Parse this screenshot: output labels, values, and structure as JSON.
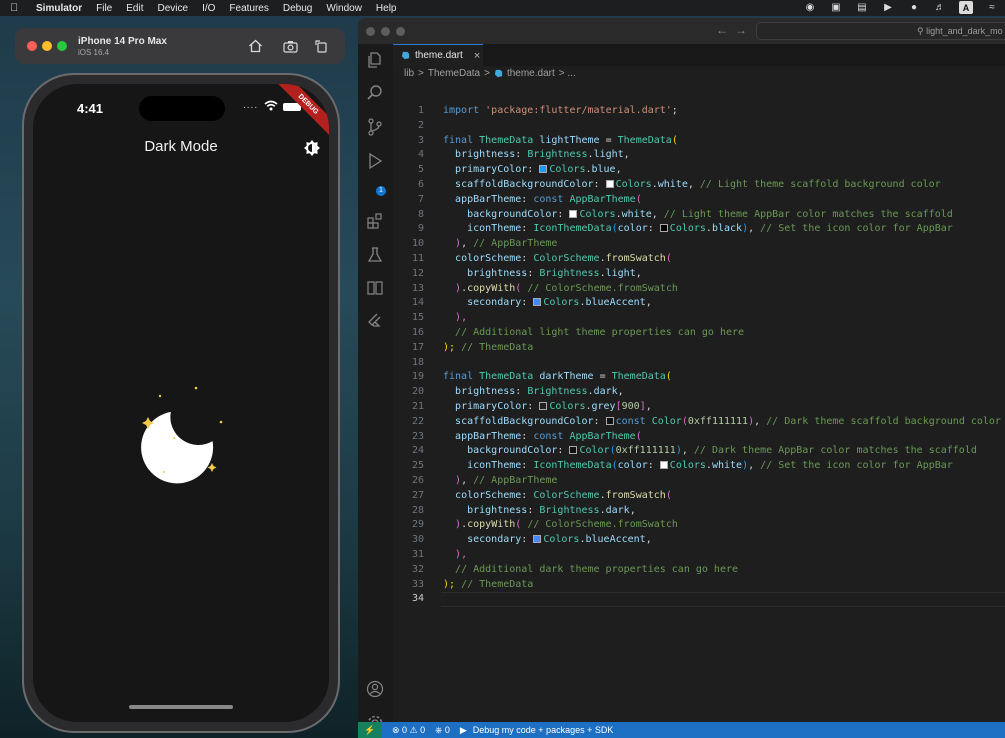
{
  "menubar": {
    "app_name": "Simulator",
    "items": [
      "File",
      "Edit",
      "Device",
      "I/O",
      "Features",
      "Debug",
      "Window",
      "Help"
    ],
    "status_icons": [
      "eye-icon",
      "screen-mirror-icon",
      "display-icon",
      "play-icon",
      "user-icon",
      "volume-icon",
      "A",
      "wifi-icon"
    ]
  },
  "simulator": {
    "device_name": "iPhone 14 Pro Max",
    "os_version": "iOS 16.4",
    "toolbar": [
      "home-icon",
      "screenshot-icon",
      "rotate-icon"
    ]
  },
  "phone": {
    "time": "4:41",
    "status_dots": "....",
    "debug_banner": "DEBUG",
    "app_title": "Dark Mode",
    "colors": {
      "background": "#161616",
      "moon": "#ffffff",
      "stars": "#f2c94c"
    }
  },
  "vscode": {
    "search_text": "light_and_dark_mo",
    "tab": {
      "filename": "theme.dart",
      "close": "×"
    },
    "breadcrumb": {
      "root": "lib",
      "sep1": ">",
      "folder": "ThemeData",
      "sep2": ">",
      "file": "theme.dart",
      "tail": "> ..."
    },
    "activity_badge": "1",
    "current_line": 34,
    "line_numbers": [
      "1",
      "2",
      "3",
      "4",
      "5",
      "6",
      "7",
      "8",
      "9",
      "10",
      "11",
      "12",
      "13",
      "14",
      "15",
      "16",
      "17",
      "18",
      "19",
      "20",
      "21",
      "22",
      "23",
      "24",
      "25",
      "26",
      "27",
      "28",
      "29",
      "30",
      "31",
      "32",
      "33",
      "34"
    ],
    "statusbar": {
      "remote": "⚡",
      "errors": "⊗ 0 ⚠ 0",
      "ports": "⎈ 0",
      "debug_config": "Debug my code + packages + SDK"
    },
    "swatch_colors": {
      "blue": "#2196f3",
      "white": "#ffffff",
      "black": "#000000",
      "grey900": "#212121",
      "dark": "#111111",
      "blueAccent": "#448aff"
    }
  },
  "code": {
    "l1": {
      "kw": "import",
      "str": "'package:flutter/material.dart'",
      "end": ";"
    },
    "l3": {
      "kw": "final",
      "ty": "ThemeData",
      "name": "lightTheme",
      "eq": " = ",
      "ty2": "ThemeData",
      "open": "("
    },
    "l4": {
      "prop": "brightness",
      "ty": "Brightness",
      "val": "light"
    },
    "l5": {
      "prop": "primaryColor",
      "ty": "Colors",
      "val": "blue"
    },
    "l6": {
      "prop": "scaffoldBackgroundColor",
      "ty": "Colors",
      "val": "white",
      "cm": "// Light theme scaffold background color"
    },
    "l7": {
      "prop": "appBarTheme",
      "kw": "const",
      "ty": "AppBarTheme",
      "open": "("
    },
    "l8": {
      "prop": "backgroundColor",
      "ty": "Colors",
      "val": "white",
      "cm": "// Light theme AppBar color matches the scaffold"
    },
    "l9": {
      "prop": "iconTheme",
      "ty": "IconThemeData",
      "prop2": "color",
      "ty2": "Colors",
      "val": "black",
      "cm": "// Set the icon color for AppBar"
    },
    "l10": {
      "close": ")",
      "cm": "// AppBarTheme"
    },
    "l11": {
      "prop": "colorScheme",
      "ty": "ColorScheme",
      "fn": "fromSwatch",
      "open": "("
    },
    "l12": {
      "prop": "brightness",
      "ty": "Brightness",
      "val": "light"
    },
    "l13": {
      "close": ")",
      "fn": "copyWith",
      "open": "(",
      "cm": "// ColorScheme.fromSwatch"
    },
    "l14": {
      "prop": "secondary",
      "ty": "Colors",
      "val": "blueAccent"
    },
    "l15": {
      "close": "),"
    },
    "l16": {
      "cm": "// Additional light theme properties can go here"
    },
    "l17": {
      "close": ");",
      "cm": "// ThemeData"
    },
    "l19": {
      "kw": "final",
      "ty": "ThemeData",
      "name": "darkTheme",
      "eq": " = ",
      "ty2": "ThemeData",
      "open": "("
    },
    "l20": {
      "prop": "brightness",
      "ty": "Brightness",
      "val": "dark"
    },
    "l21": {
      "prop": "primaryColor",
      "ty": "Colors",
      "val": "grey",
      "idx": "900"
    },
    "l22": {
      "prop": "scaffoldBackgroundColor",
      "kw": "const",
      "ty": "Color",
      "num": "0xff111111",
      "cm": "// Dark theme scaffold background color"
    },
    "l23": {
      "prop": "appBarTheme",
      "kw": "const",
      "ty": "AppBarTheme",
      "open": "("
    },
    "l24": {
      "prop": "backgroundColor",
      "ty": "Color",
      "num": "0xff111111",
      "cm": "// Dark theme AppBar color matches the scaffold"
    },
    "l25": {
      "prop": "iconTheme",
      "ty": "IconThemeData",
      "prop2": "color",
      "ty2": "Colors",
      "val": "white",
      "cm": "// Set the icon color for AppBar"
    },
    "l26": {
      "close": ")",
      "cm": "// AppBarTheme"
    },
    "l27": {
      "prop": "colorScheme",
      "ty": "ColorScheme",
      "fn": "fromSwatch",
      "open": "("
    },
    "l28": {
      "prop": "brightness",
      "ty": "Brightness",
      "val": "dark"
    },
    "l29": {
      "close": ")",
      "fn": "copyWith",
      "open": "(",
      "cm": "// ColorScheme.fromSwatch"
    },
    "l30": {
      "prop": "secondary",
      "ty": "Colors",
      "val": "blueAccent"
    },
    "l31": {
      "close": "),"
    },
    "l32": {
      "cm": "// Additional dark theme properties can go here"
    },
    "l33": {
      "close": ");",
      "cm": "// ThemeData"
    }
  }
}
